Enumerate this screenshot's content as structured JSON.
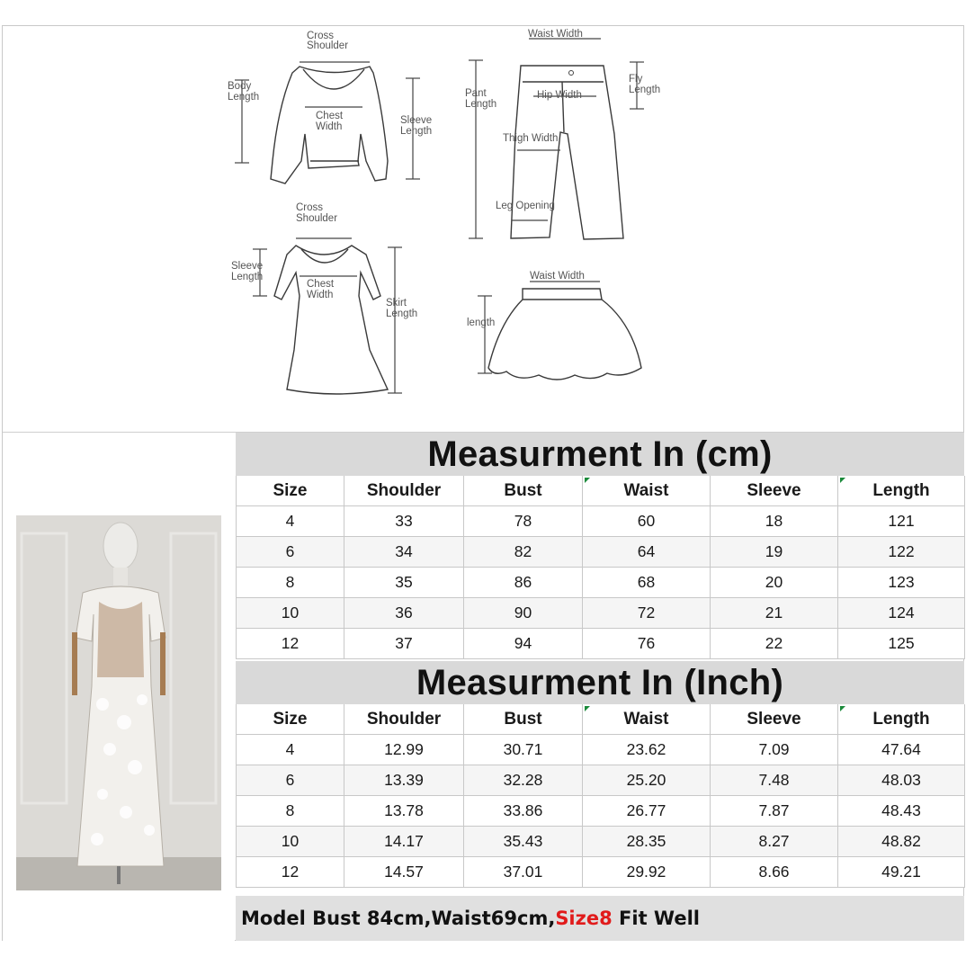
{
  "diagram": {
    "top_labels": {
      "cross_shoulder_1": "Cross",
      "cross_shoulder_2": "Shoulder",
      "body_length_1": "Body",
      "body_length_2": "Length",
      "chest_width_1": "Chest",
      "chest_width_2": "Width",
      "sleeve_length_1": "Sleeve",
      "sleeve_length_2": "Length"
    },
    "pants_labels": {
      "waist_width": "Waist Width",
      "pant_length_1": "Pant",
      "pant_length_2": "Length",
      "hip_width": "Hip Width",
      "fly_length_1": "Fly",
      "fly_length_2": "Length",
      "thigh_width": "Thigh Width",
      "leg_opening": "Leg Opening"
    },
    "dress_labels": {
      "cross_shoulder_1": "Cross",
      "cross_shoulder_2": "Shoulder",
      "sleeve_length_1": "Sleeve",
      "sleeve_length_2": "Length",
      "chest_width_1": "Chest",
      "chest_width_2": "Width",
      "skirt_length_1": "Skirt",
      "skirt_length_2": "Length"
    },
    "skirt_labels": {
      "waist_width": "Waist Width",
      "length": "length"
    }
  },
  "photo": {
    "subject": "lace-dress-on-mannequin"
  },
  "cm_table": {
    "title": "Measurment In (cm)",
    "headers": [
      "Size",
      "Shoulder",
      "Bust",
      "Waist",
      "Sleeve",
      "Length"
    ],
    "rows": [
      [
        "4",
        "33",
        "78",
        "60",
        "18",
        "121"
      ],
      [
        "6",
        "34",
        "82",
        "64",
        "19",
        "122"
      ],
      [
        "8",
        "35",
        "86",
        "68",
        "20",
        "123"
      ],
      [
        "10",
        "36",
        "90",
        "72",
        "21",
        "124"
      ],
      [
        "12",
        "37",
        "94",
        "76",
        "22",
        "125"
      ]
    ]
  },
  "inch_table": {
    "title": "Measurment In (Inch)",
    "headers": [
      "Size",
      "Shoulder",
      "Bust",
      "Waist",
      "Sleeve",
      "Length"
    ],
    "rows": [
      [
        "4",
        "12.99",
        "30.71",
        "23.62",
        "7.09",
        "47.64"
      ],
      [
        "6",
        "13.39",
        "32.28",
        "25.20",
        "7.48",
        "48.03"
      ],
      [
        "8",
        "13.78",
        "33.86",
        "26.77",
        "7.87",
        "48.43"
      ],
      [
        "10",
        "14.17",
        "35.43",
        "28.35",
        "8.27",
        "48.82"
      ],
      [
        "12",
        "14.57",
        "37.01",
        "29.92",
        "8.66",
        "49.21"
      ]
    ]
  },
  "footer": {
    "prefix": "Model Bust 84cm,Waist69cm,",
    "highlight": "Size8",
    "suffix": " Fit Well",
    "highlight_color": "#e11b1b"
  },
  "colors": {
    "band": "#d9d9d9",
    "grid": "#c8c8c8",
    "tick": "#1a8a3a"
  }
}
